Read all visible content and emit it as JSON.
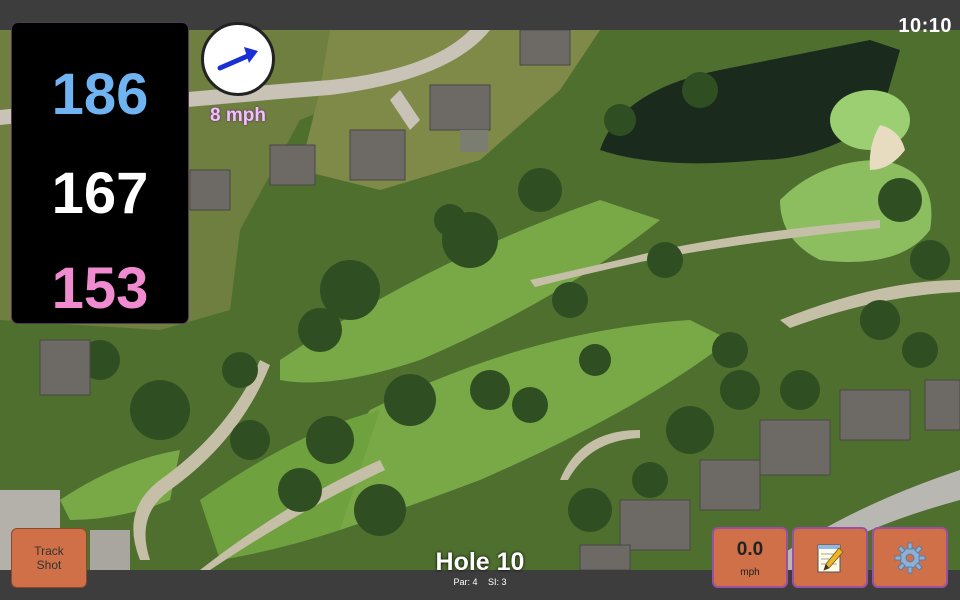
{
  "status_bar": {
    "time": "10:10"
  },
  "distances": {
    "back": "186",
    "middle": "167",
    "front": "153",
    "colors": {
      "back": "#6fb3f0",
      "middle": "#ffffff",
      "front": "#f08bd0"
    }
  },
  "wind": {
    "speed_label": "8 mph",
    "direction_icon": "wind-arrow-icon",
    "arrow_color": "#1a2fd6"
  },
  "buttons": {
    "track_shot_line1": "Track",
    "track_shot_line2": "Shot",
    "speed_value": "0.0",
    "speed_unit": "mph",
    "notes_icon": "notepad-pencil-icon",
    "settings_icon": "gear-icon",
    "button_color": "#cf7048"
  },
  "hole": {
    "title": "Hole 10",
    "par": "Par: 4",
    "si": "SI: 3"
  }
}
